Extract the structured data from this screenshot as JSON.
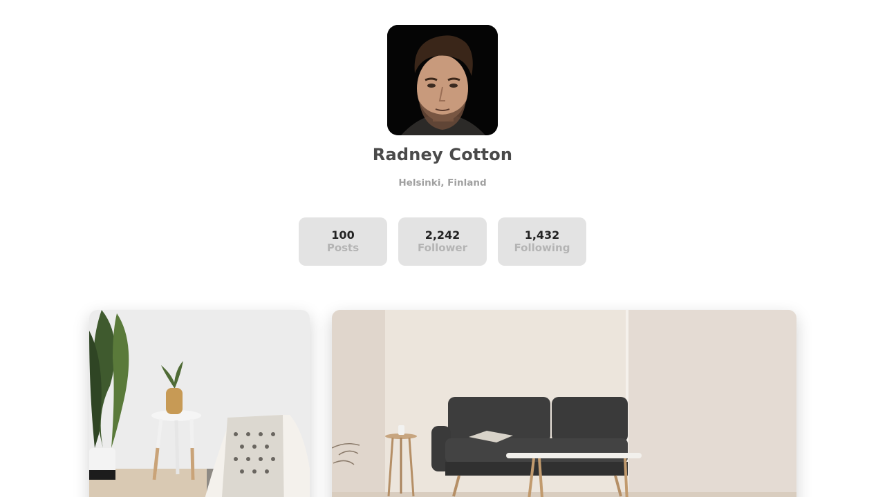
{
  "profile": {
    "name": "Radney Cotton",
    "location": "Helsinki, Finland",
    "avatar_icon": "avatar-photo"
  },
  "stats": [
    {
      "value": "100",
      "label": "Posts"
    },
    {
      "value": "2,242",
      "label": "Follower"
    },
    {
      "value": "1,432",
      "label": "Following"
    }
  ],
  "gallery": {
    "photos": [
      {
        "icon": "interior-photo-plant-stool"
      },
      {
        "icon": "interior-photo-sofa"
      }
    ]
  },
  "colors": {
    "background": "#ffffff",
    "name_text": "#4a4a4a",
    "location_text": "#a0a0a0",
    "stat_bg": "#e3e3e3",
    "stat_value": "#222222",
    "stat_label": "#b4b4b4"
  }
}
